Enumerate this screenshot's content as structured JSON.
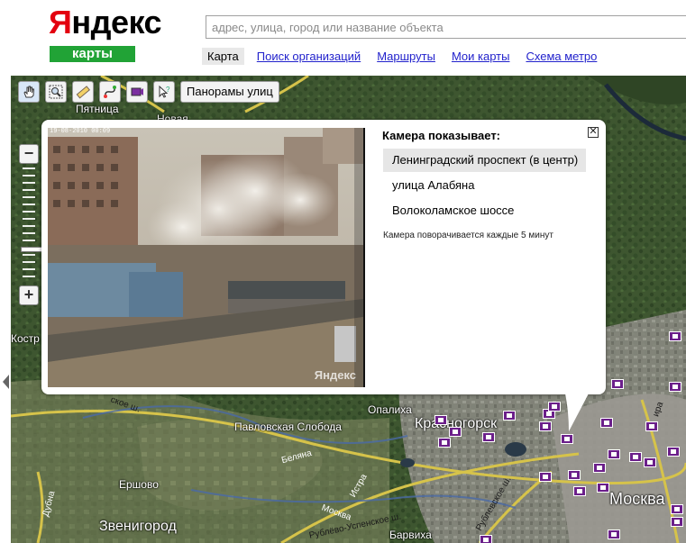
{
  "header": {
    "logo_first": "Я",
    "logo_rest": "ндекс",
    "logo_badge": "карты",
    "search_placeholder": "адрес, улица, город или название объекта"
  },
  "nav": {
    "items": [
      {
        "label": "Карта",
        "active": true
      },
      {
        "label": "Поиск организаций",
        "active": false
      },
      {
        "label": "Маршруты",
        "active": false
      },
      {
        "label": "Мои карты",
        "active": false
      },
      {
        "label": "Схема метро",
        "active": false
      }
    ]
  },
  "toolbar": {
    "tools": [
      "hand-icon",
      "zoom-box-icon",
      "ruler-icon",
      "route-icon",
      "camera-icon",
      "info-pointer-icon"
    ],
    "panorama_label": "Панорамы улиц"
  },
  "zoom": {
    "plus": "+",
    "minus": "−",
    "level_fraction": 0.72
  },
  "map": {
    "labels": {
      "pyatnitsa": "Пятница",
      "novaya": "Новая",
      "kostr": "Костр",
      "opalikha": "Опалиха",
      "pavlovskaya": "Павловская Слобода",
      "krasnogorsk": "Красногорск",
      "ershovo": "Ершово",
      "zvenigorod": "Звенигород",
      "barvikha": "Барвиха",
      "moskva": "Москва",
      "sh1": "ское ш.",
      "belyana": "Беляна",
      "istra": "Истра",
      "moskva_river": "Москва",
      "rublevskoe": "Рублевское ш.",
      "rublevo_uspenskoe": "Рублёво-Успенское ш.",
      "dubna": "Дубна",
      "ira": "ира"
    }
  },
  "balloon": {
    "heading": "Камера показывает:",
    "directions": [
      {
        "label": "Ленинградский проспект (в центр)",
        "selected": true
      },
      {
        "label": "улица Алабяна",
        "selected": false
      },
      {
        "label": "Волоколамское шоссе",
        "selected": false
      }
    ],
    "note": "Камера поворачивается каждые 5 минут",
    "timestamp": "19-08-2010 00:09",
    "watermark": "Яндекс",
    "close": "✕"
  },
  "colors": {
    "brand_red": "#e3000f",
    "brand_green": "#21a336",
    "link": "#2222cc",
    "marker": "#6b1f8a"
  }
}
